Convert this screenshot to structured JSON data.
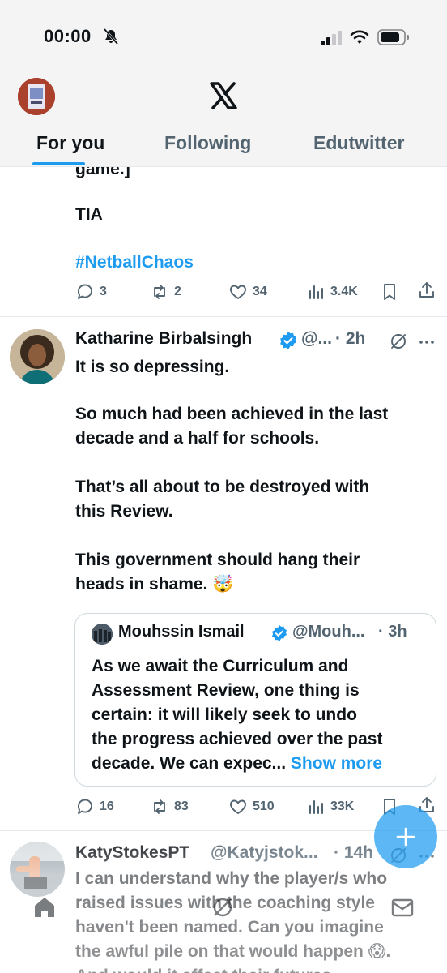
{
  "status_bar": {
    "time": "00:00"
  },
  "header": {
    "tabs": [
      {
        "label": "For you",
        "active": true
      },
      {
        "label": "Following",
        "active": false
      },
      {
        "label": "Edutwitter",
        "active": false
      }
    ]
  },
  "post1": {
    "partial_text": "game.]",
    "line1": "TIA",
    "hashtag": "#NetballChaos",
    "replies": "3",
    "reposts": "2",
    "likes": "34",
    "views": "3.4K"
  },
  "post2": {
    "name": "Katharine Birbalsingh",
    "handle": "@...",
    "time": "· 2h",
    "lines": [
      "It is so depressing.",
      "So much had been achieved in the last",
      "decade and a half for schools.",
      "That’s all about to be destroyed with",
      "this Review.",
      "This government should hang their",
      "heads in shame. 🤯"
    ],
    "quote": {
      "name": "Mouhssin Ismail",
      "handle": "@Mouh...",
      "time": "· 3h",
      "lines": [
        "As we await the Curriculum and",
        "Assessment Review, one thing is",
        "certain: it will likely seek to undo",
        "the progress achieved over the past",
        "decade. We can expec..."
      ],
      "show_more": "Show more"
    },
    "replies": "16",
    "reposts": "83",
    "likes": "510",
    "views": "33K"
  },
  "post3": {
    "name": "KatyStokesPT",
    "handle": "@Katyjstok...",
    "time": "· 14h",
    "lines": [
      "I can understand why the player/s who",
      "raised issues with the coaching style",
      "haven't been named. Can you imagine",
      "the awful pile on that would happen 😱.",
      "And would it affect their futures..."
    ]
  },
  "colors": {
    "accent": "#1d9bf0",
    "text": "#0f1419",
    "muted": "#536471",
    "verified": "#1d9bf0"
  },
  "icons": [
    "bell-slash-icon",
    "signal-icon",
    "wifi-icon",
    "battery-icon",
    "x-logo-icon",
    "verified-icon",
    "grok-icon",
    "more-icon",
    "reply-icon",
    "repost-icon",
    "like-icon",
    "views-icon",
    "bookmark-icon",
    "share-icon",
    "plus-icon",
    "home-icon",
    "communities-icon",
    "mail-icon"
  ]
}
